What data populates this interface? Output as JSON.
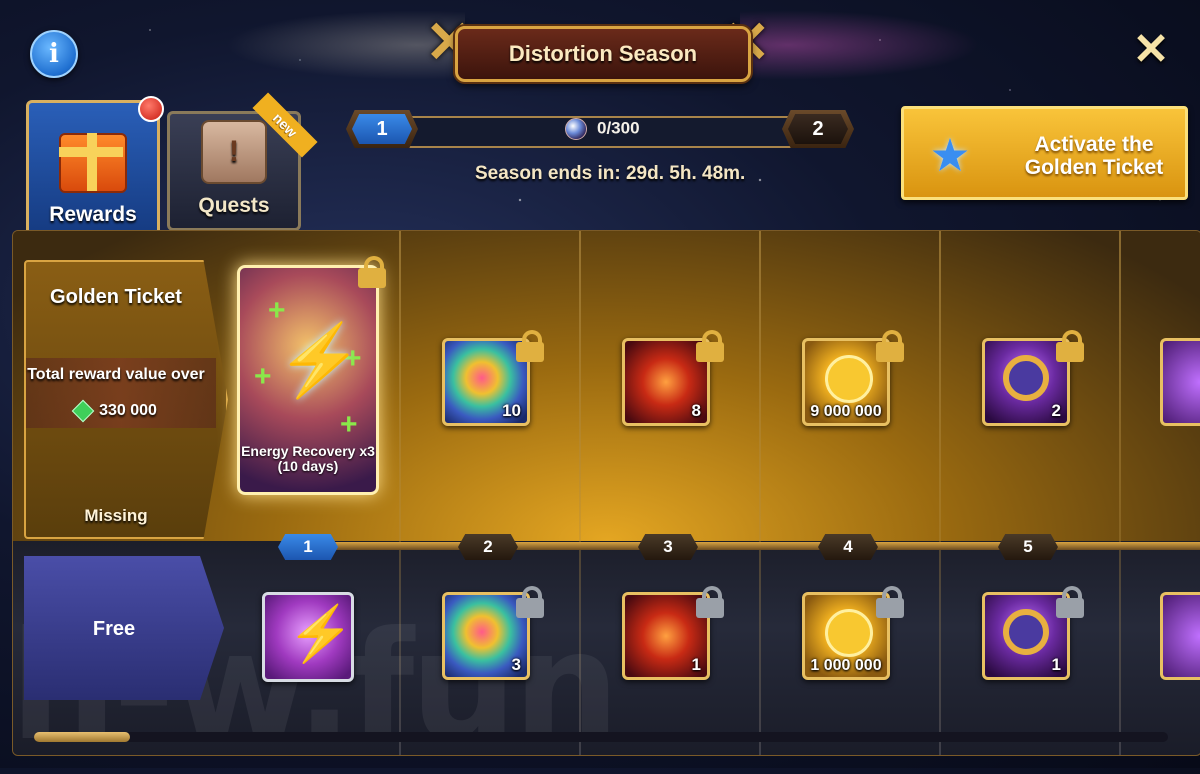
{
  "header": {
    "title": "Distortion Season"
  },
  "tabs": [
    {
      "label": "Rewards",
      "active": true,
      "notification": true
    },
    {
      "label": "Quests",
      "badge": "new"
    }
  ],
  "progress": {
    "current_level": "1",
    "next_level": "2",
    "points": "0/300",
    "season_ends": "Season ends in: 29d. 5h. 48m."
  },
  "golden_button": {
    "label": "Activate the Golden Ticket"
  },
  "golden_ticket": {
    "title": "Golden Ticket",
    "value_label": "Total reward value over",
    "value": "330 000",
    "status": "Missing"
  },
  "free_row": {
    "label": "Free"
  },
  "featured_reward": {
    "label": "Energy Recovery x3 (10 days)"
  },
  "levels": [
    "1",
    "2",
    "3",
    "4",
    "5"
  ],
  "golden_rewards": [
    {
      "icon": "chaos-orb-icon",
      "qty": "10"
    },
    {
      "icon": "fire-artifact-icon",
      "qty": "8"
    },
    {
      "icon": "gold-coin-icon",
      "qty": "9 000 000"
    },
    {
      "icon": "magnifier-icon",
      "qty": "2"
    }
  ],
  "free_rewards": [
    {
      "icon": "energy-icon",
      "qty": ""
    },
    {
      "icon": "chaos-orb-icon",
      "qty": "3"
    },
    {
      "icon": "fire-artifact-icon",
      "qty": "1"
    },
    {
      "icon": "gold-coin-icon",
      "qty": "1 000 000"
    },
    {
      "icon": "magnifier-icon",
      "qty": "1"
    }
  ],
  "watermark": "h-w.fun",
  "colors": {
    "gold": "#d9a442",
    "accent_blue": "#2a6fd0",
    "golden_button": "#f0b020"
  }
}
